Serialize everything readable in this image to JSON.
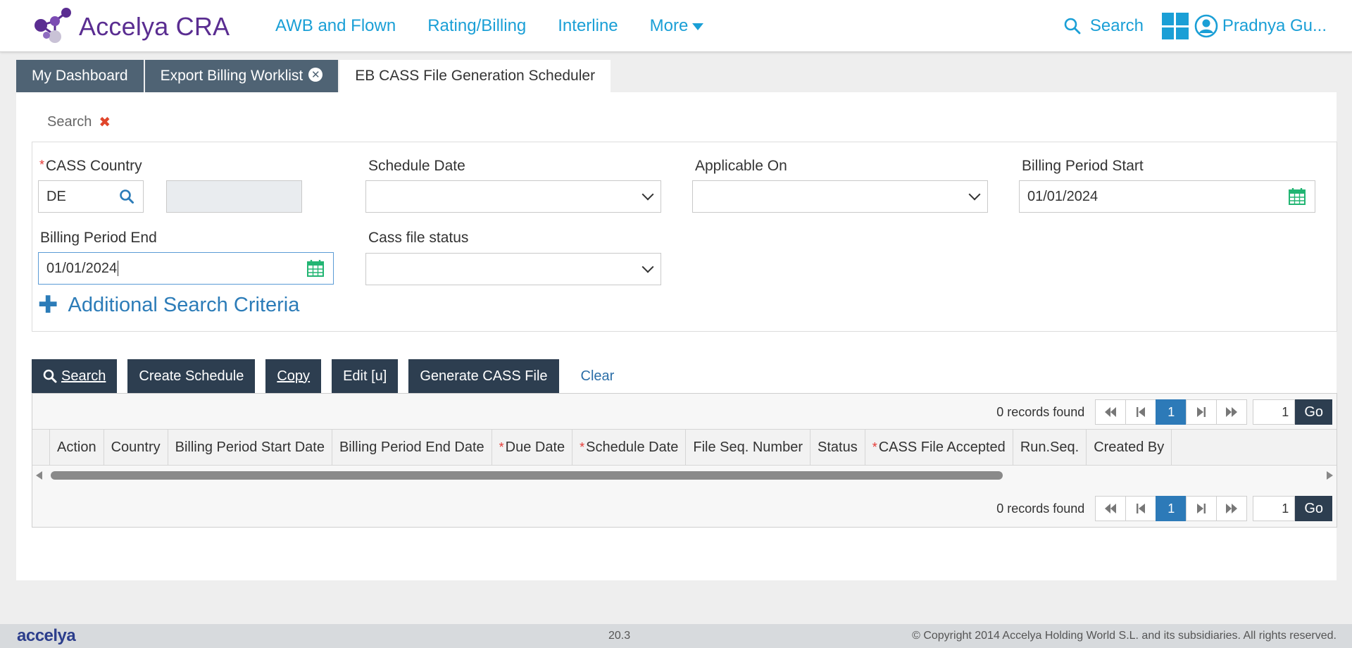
{
  "app": {
    "title": "Accelya CRA"
  },
  "nav": [
    "AWB and Flown",
    "Rating/Billing",
    "Interline",
    "More"
  ],
  "header": {
    "search_label": "Search",
    "user_name": "Pradnya Gu..."
  },
  "tabs": [
    {
      "label": "My Dashboard"
    },
    {
      "label": "Export Billing Worklist"
    },
    {
      "label": "EB CASS File Generation Scheduler"
    }
  ],
  "search_panel": {
    "title": "Search",
    "fields": {
      "cass_country": {
        "label": "CASS Country",
        "value": "DE",
        "name_value": ""
      },
      "schedule_date": {
        "label": "Schedule Date",
        "value": ""
      },
      "applicable_on": {
        "label": "Applicable On",
        "value": ""
      },
      "billing_period_start": {
        "label": "Billing Period Start",
        "value": "01/01/2024"
      },
      "billing_period_end": {
        "label": "Billing Period End",
        "value": "01/01/2024"
      },
      "cass_file_status": {
        "label": "Cass file status",
        "value": ""
      }
    },
    "additional_criteria": "Additional Search Criteria"
  },
  "buttons": {
    "search": "Search",
    "create_schedule": "Create Schedule",
    "copy": "Copy",
    "edit": "Edit [u]",
    "generate": "Generate CASS File",
    "clear": "Clear"
  },
  "grid": {
    "records_text": "0 records found",
    "current_page": "1",
    "page_input": "1",
    "go_label": "Go",
    "columns": [
      "Action",
      "Country",
      "Billing Period Start Date",
      "Billing Period End Date",
      "Due Date",
      "Schedule Date",
      "File Seq. Number",
      "Status",
      "CASS File Accepted",
      "Run.Seq.",
      "Created By"
    ],
    "required_columns": [
      "Due Date",
      "Schedule Date",
      "CASS File Accepted"
    ]
  },
  "footer": {
    "brand": "accelya",
    "version": "20.3",
    "copyright": "© Copyright 2014 Accelya Holding World S.L. and its subsidiaries. All rights reserved."
  },
  "colors": {
    "accent": "#1a9fd6",
    "brand": "#5a2d91",
    "dark_button": "#2d3e50",
    "tab_bg": "#4f6374",
    "required": "#e53935"
  },
  "icons": [
    "accelya-logo",
    "search-icon",
    "apps-grid-icon",
    "user-icon",
    "close-circle-icon",
    "close-icon",
    "calendar-icon",
    "chevron-down-icon",
    "plus-icon",
    "first-page-icon",
    "prev-page-icon",
    "next-page-icon",
    "last-page-icon"
  ]
}
